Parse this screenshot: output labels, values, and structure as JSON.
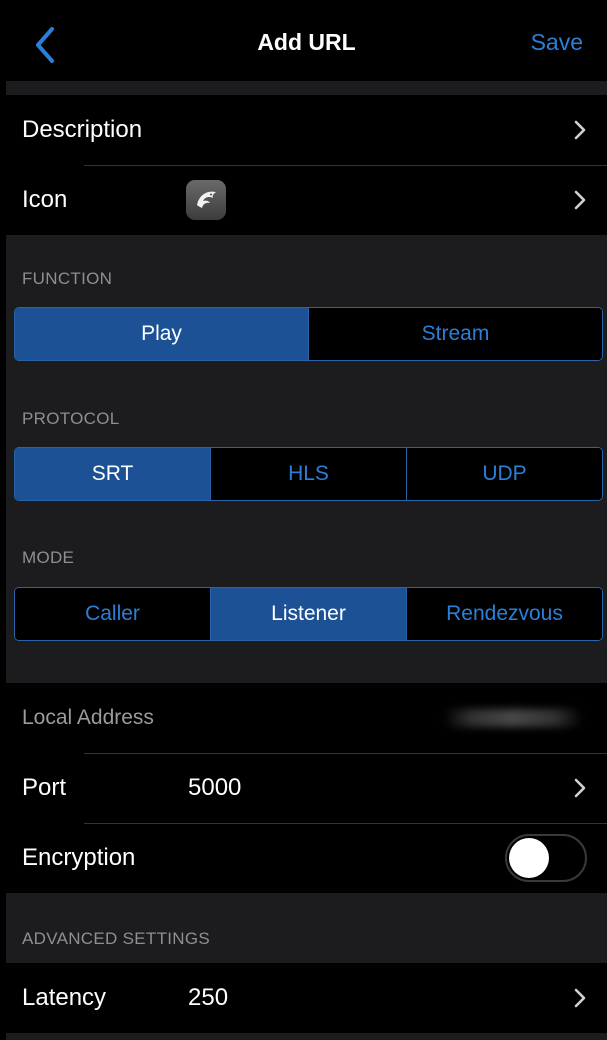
{
  "nav": {
    "title": "Add URL",
    "save_label": "Save",
    "back_icon": "chevron-left-icon"
  },
  "general": {
    "description_label": "Description",
    "icon_label": "Icon",
    "icon_name": "shark-app-icon"
  },
  "function": {
    "header": "FUNCTION",
    "options": [
      "Play",
      "Stream"
    ],
    "selected": "Play"
  },
  "protocol": {
    "header": "PROTOCOL",
    "options": [
      "SRT",
      "HLS",
      "UDP"
    ],
    "selected": "SRT"
  },
  "mode": {
    "header": "MODE",
    "options": [
      "Caller",
      "Listener",
      "Rendezvous"
    ],
    "selected": "Listener"
  },
  "connection": {
    "local_address_label": "Local Address",
    "port_label": "Port",
    "port_value": "5000",
    "encryption_label": "Encryption",
    "encryption_enabled": false
  },
  "advanced": {
    "header": "ADVANCED SETTINGS",
    "latency_label": "Latency",
    "latency_value": "250"
  },
  "colors": {
    "accent": "#2c7fd8",
    "selected_segment": "#1c5196",
    "background": "#1c1c1e",
    "row_background": "#000000"
  }
}
